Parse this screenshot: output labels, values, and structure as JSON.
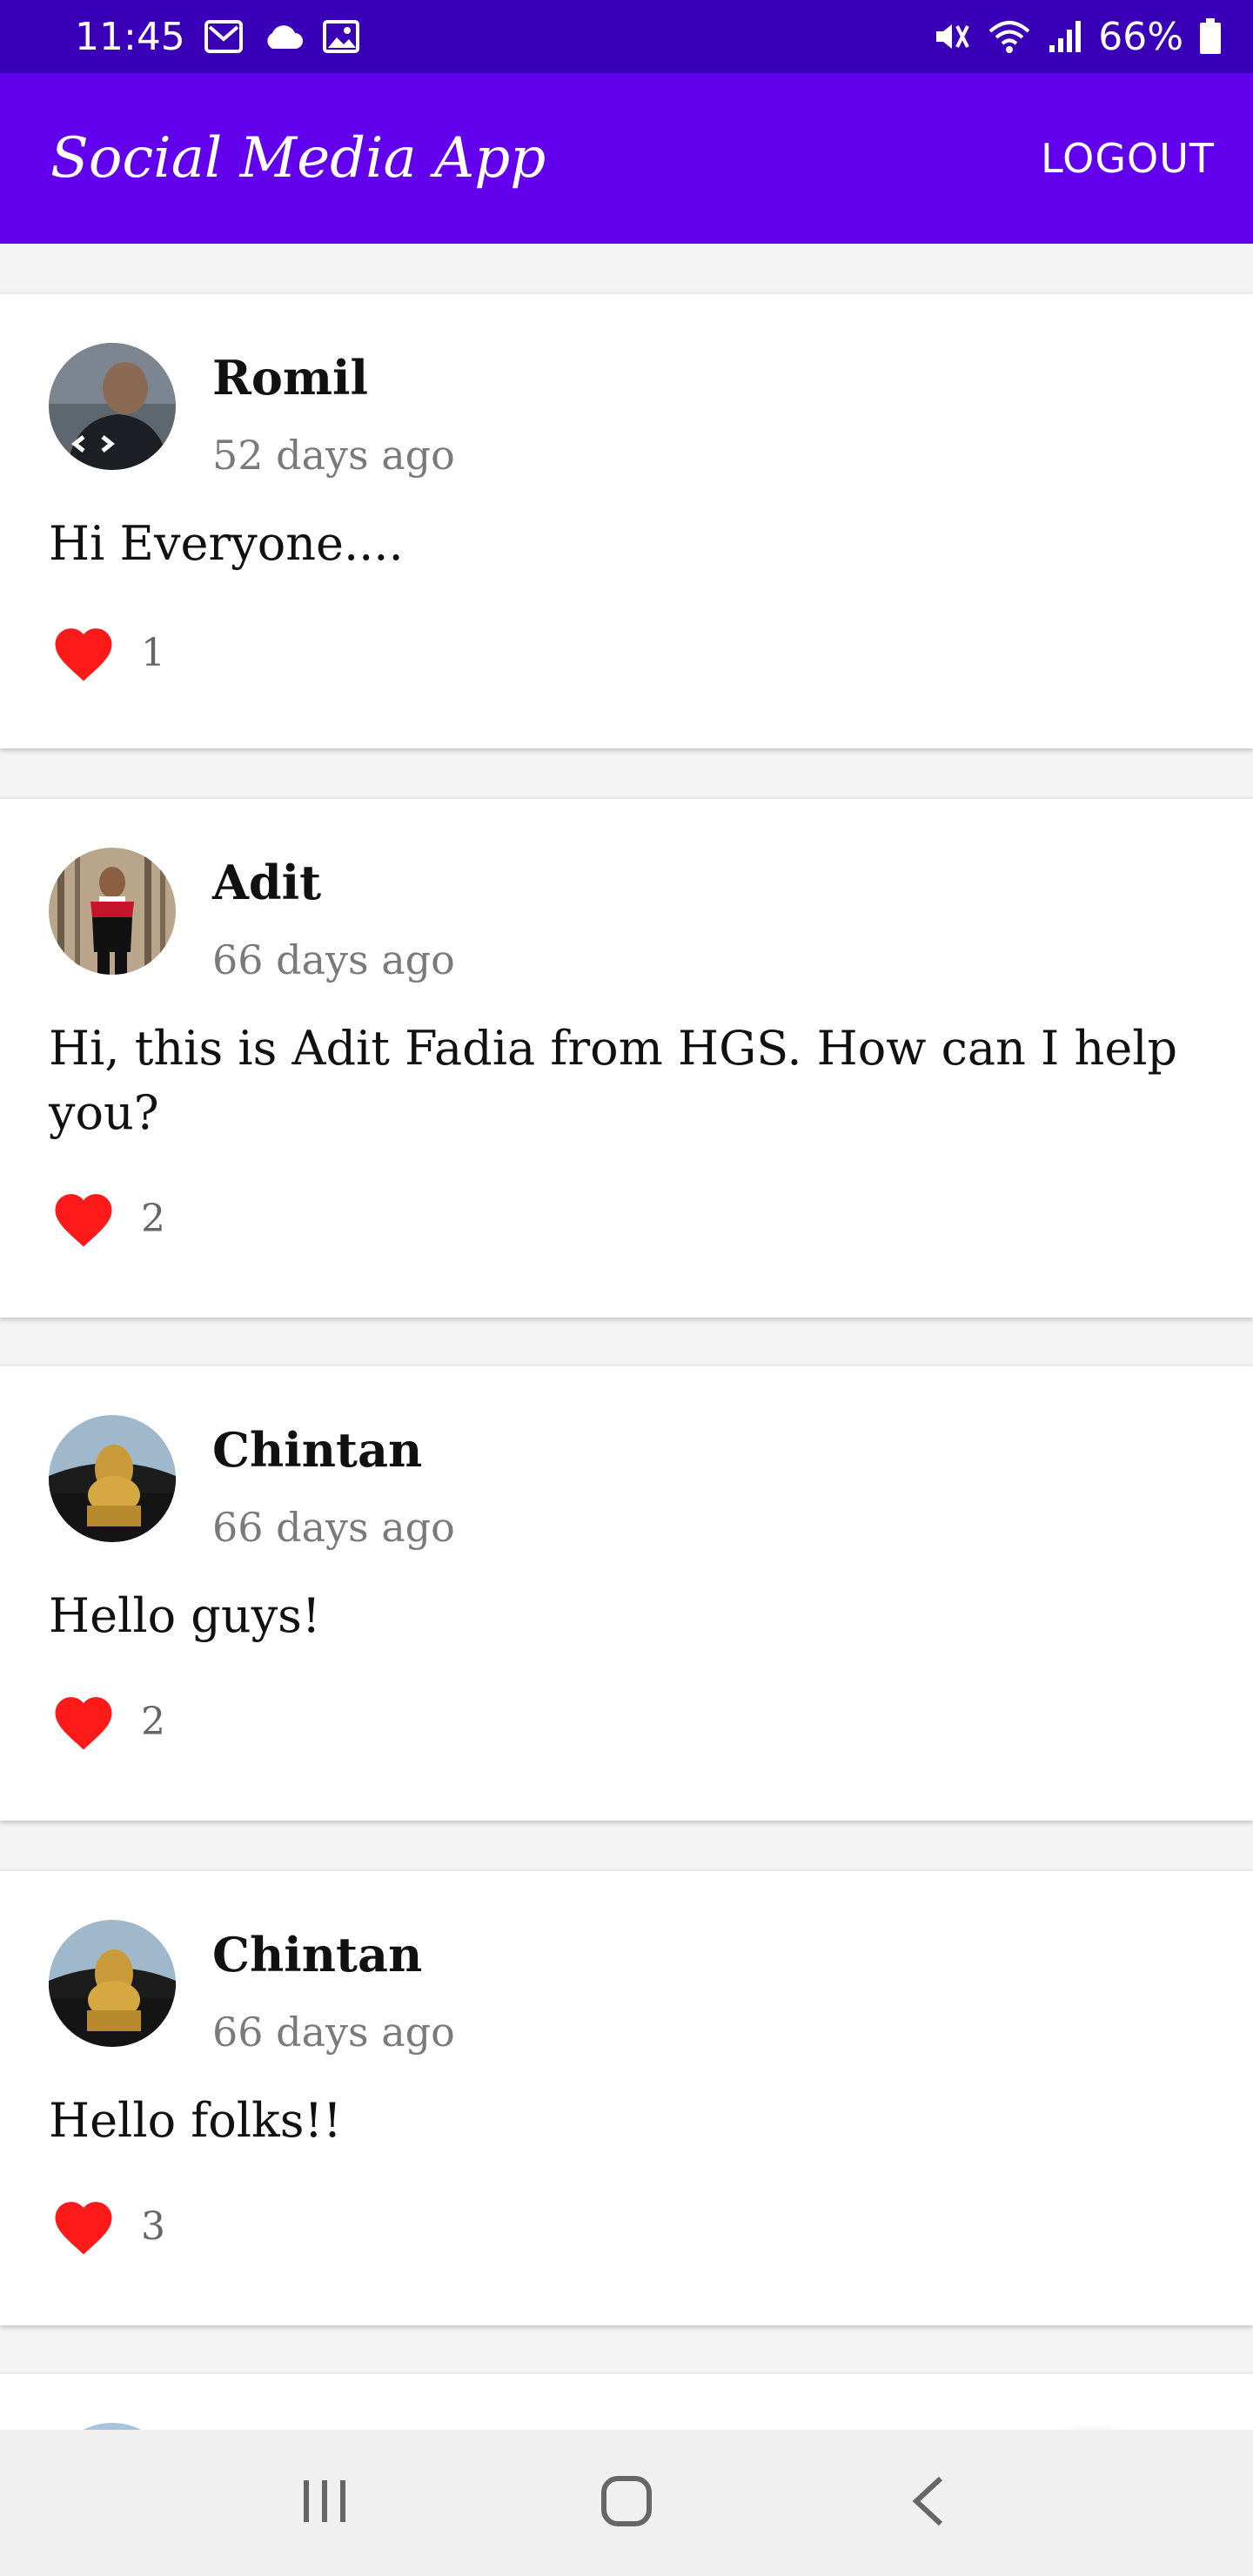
{
  "status_bar": {
    "time": "11:45",
    "battery_percent": "66%",
    "icons_left": [
      "mail-icon",
      "cloud-icon",
      "image-icon"
    ],
    "icons_right": [
      "mute-icon",
      "wifi-icon",
      "signal-icon",
      "battery-icon"
    ]
  },
  "app_bar": {
    "title": "Social Media App",
    "logout_label": "LOGOUT"
  },
  "posts": [
    {
      "name": "Romil",
      "time": "52 days ago",
      "text": "Hi Everyone....",
      "likes": "1"
    },
    {
      "name": "Adit",
      "time": "66 days ago",
      "text": "Hi, this is Adit Fadia from HGS. How can I help you?",
      "likes": "2"
    },
    {
      "name": "Chintan",
      "time": "66 days ago",
      "text": "Hello guys!",
      "likes": "2"
    },
    {
      "name": "Chintan",
      "time": "66 days ago",
      "text": "Hello folks!!",
      "likes": "3"
    }
  ],
  "colors": {
    "status_bar": "#3a00b8",
    "app_bar": "#6200ee",
    "heart": "#ff1a1a",
    "fab": "#03dac5"
  },
  "fab": {
    "icon": "plus-icon"
  },
  "nav_bar": {
    "icons": [
      "recent-apps-icon",
      "home-icon",
      "back-icon"
    ]
  }
}
